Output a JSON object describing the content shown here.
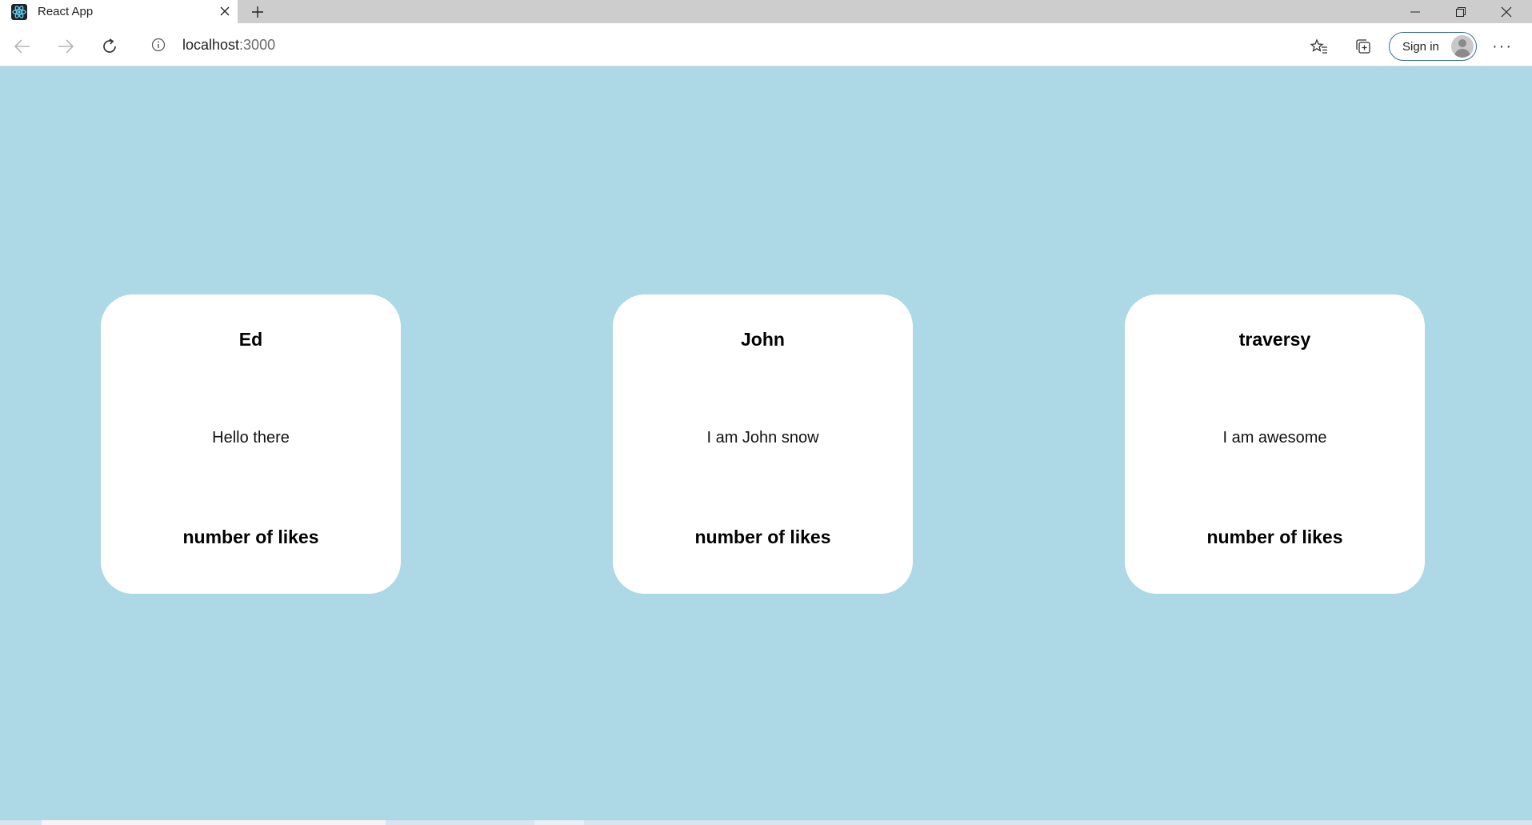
{
  "browser": {
    "tab_title": "React App",
    "url_host": "localhost",
    "url_port": ":3000",
    "sign_in_label": "Sign in",
    "more_label": "···"
  },
  "page": {
    "background_color": "#add8e6",
    "cards": [
      {
        "name": "Ed",
        "text": "Hello there",
        "likes_label": "number of likes"
      },
      {
        "name": "John",
        "text": "I am John snow",
        "likes_label": "number of likes"
      },
      {
        "name": "traversy",
        "text": "I am awesome",
        "likes_label": "number of likes"
      }
    ]
  },
  "icons": {
    "favicon": "react-logo-icon",
    "tab_close": "close-icon",
    "new_tab": "plus-icon",
    "back": "back-arrow-icon",
    "forward": "forward-arrow-icon",
    "refresh": "refresh-icon",
    "info": "info-icon",
    "favorite": "star-icon",
    "favorites": "favorites-icon",
    "collections": "collections-icon",
    "minimize": "minimize-icon",
    "restore": "restore-icon",
    "close_window": "close-icon"
  }
}
